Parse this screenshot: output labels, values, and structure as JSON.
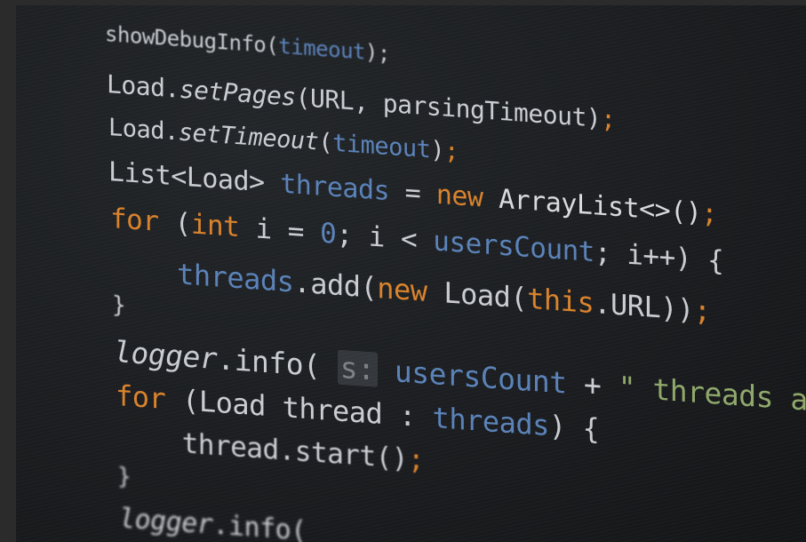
{
  "code_lines": [
    [
      {
        "text": "showDebugInfo(",
        "kind": "default"
      },
      {
        "text": "timeout",
        "kind": "field"
      },
      {
        "text": ");",
        "kind": "default"
      }
    ],
    [
      {
        "text": "Load.",
        "kind": "default"
      },
      {
        "text": "setPages",
        "kind": "default",
        "italic": true
      },
      {
        "text": "(URL, parsingTimeout)",
        "kind": "default"
      },
      {
        "text": ";",
        "kind": "keyword"
      }
    ],
    [
      {
        "text": "Load.",
        "kind": "default"
      },
      {
        "text": "setTimeout",
        "kind": "default",
        "italic": true
      },
      {
        "text": "(",
        "kind": "default"
      },
      {
        "text": "timeout",
        "kind": "field"
      },
      {
        "text": ")",
        "kind": "default"
      },
      {
        "text": ";",
        "kind": "keyword"
      }
    ],
    [
      {
        "text": "List<Load> ",
        "kind": "default"
      },
      {
        "text": "threads",
        "kind": "field"
      },
      {
        "text": " = ",
        "kind": "default"
      },
      {
        "text": "new ",
        "kind": "keyword"
      },
      {
        "text": "ArrayList<>()",
        "kind": "type"
      },
      {
        "text": ";",
        "kind": "keyword"
      }
    ],
    [
      {
        "text": "for ",
        "kind": "keyword"
      },
      {
        "text": "(",
        "kind": "default"
      },
      {
        "text": "int ",
        "kind": "keyword"
      },
      {
        "text": "i = ",
        "kind": "default"
      },
      {
        "text": "0",
        "kind": "field"
      },
      {
        "text": "; i < ",
        "kind": "default"
      },
      {
        "text": "usersCount",
        "kind": "field"
      },
      {
        "text": "; i++) {",
        "kind": "default"
      }
    ],
    [
      {
        "text": "    ",
        "kind": "default"
      },
      {
        "text": "threads",
        "kind": "field"
      },
      {
        "text": ".add(",
        "kind": "default"
      },
      {
        "text": "new ",
        "kind": "keyword"
      },
      {
        "text": "Load(",
        "kind": "default"
      },
      {
        "text": "this",
        "kind": "keyword"
      },
      {
        "text": ".URL))",
        "kind": "default"
      },
      {
        "text": ";",
        "kind": "keyword"
      }
    ],
    [
      {
        "text": "}",
        "kind": "default"
      }
    ],
    [
      {
        "text": "logger",
        "kind": "default",
        "italic": true
      },
      {
        "text": ".info( ",
        "kind": "default"
      },
      {
        "text": "s:",
        "kind": "hint"
      },
      {
        "text": " usersCount",
        "kind": "field"
      },
      {
        "text": " + ",
        "kind": "default"
      },
      {
        "text": "\" threads are cre",
        "kind": "string"
      }
    ],
    [
      {
        "text": "for ",
        "kind": "keyword"
      },
      {
        "text": "(Load thread : ",
        "kind": "default"
      },
      {
        "text": "threads",
        "kind": "field"
      },
      {
        "text": ") {",
        "kind": "default"
      }
    ],
    [
      {
        "text": "    thread.start()",
        "kind": "default"
      },
      {
        "text": ";",
        "kind": "keyword"
      }
    ],
    [
      {
        "text": "}",
        "kind": "default"
      }
    ],
    [
      {
        "text": "logger",
        "kind": "default",
        "italic": true
      },
      {
        "text": ".info(",
        "kind": "default"
      }
    ]
  ],
  "colors": {
    "background": "#1b1d20",
    "default": "#c9ccd1",
    "field": "#5a82b8",
    "keyword": "#d9822b",
    "string": "#8fa86a"
  }
}
